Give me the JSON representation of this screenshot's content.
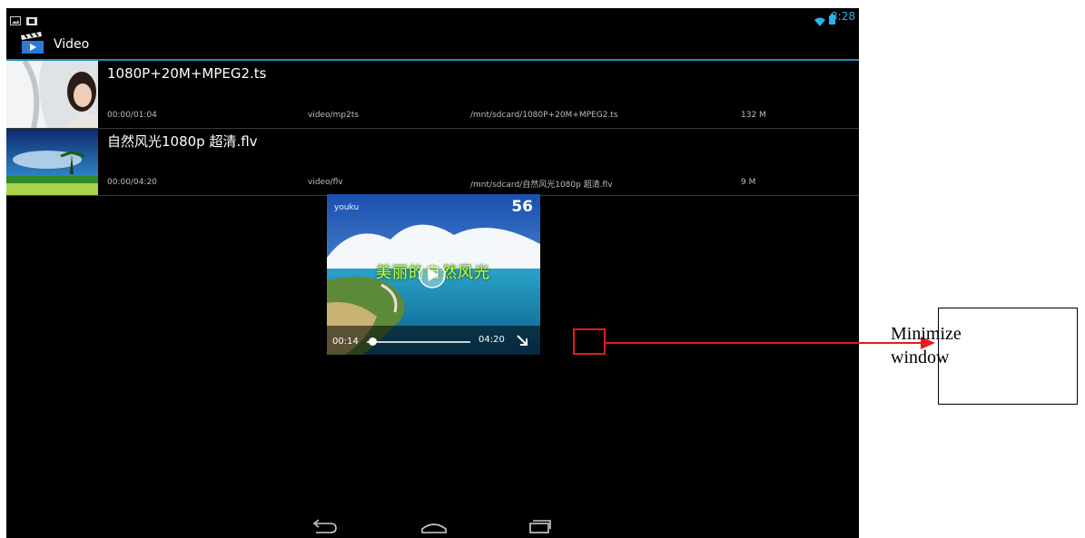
{
  "status_bar": {
    "time": "3:28"
  },
  "action_bar": {
    "title": "Video"
  },
  "videos": [
    {
      "name": "1080P+20M+MPEG2.ts",
      "position": "00:00/01:04",
      "mime": "video/mp2ts",
      "path": "/mnt/sdcard/1080P+20M+MPEG2.ts",
      "size": "132 M"
    },
    {
      "name": "自然风光1080p 超清.flv",
      "position": "00:00/04:20",
      "mime": "video/flv",
      "path": "/mnt/sdcard/自然风光1080p 超清.flv",
      "size": "9 M"
    }
  ],
  "player": {
    "current_time": "00:14",
    "total_time": "04:20",
    "progress": 0.05,
    "logo_left": "youku",
    "logo_right": "56",
    "caption": "美丽的自然风光"
  },
  "annotation": {
    "label": "Minimize window"
  },
  "colors": {
    "accent": "#2fb0e6",
    "highlight": "#e31b1b",
    "caption": "#c7ff56"
  }
}
